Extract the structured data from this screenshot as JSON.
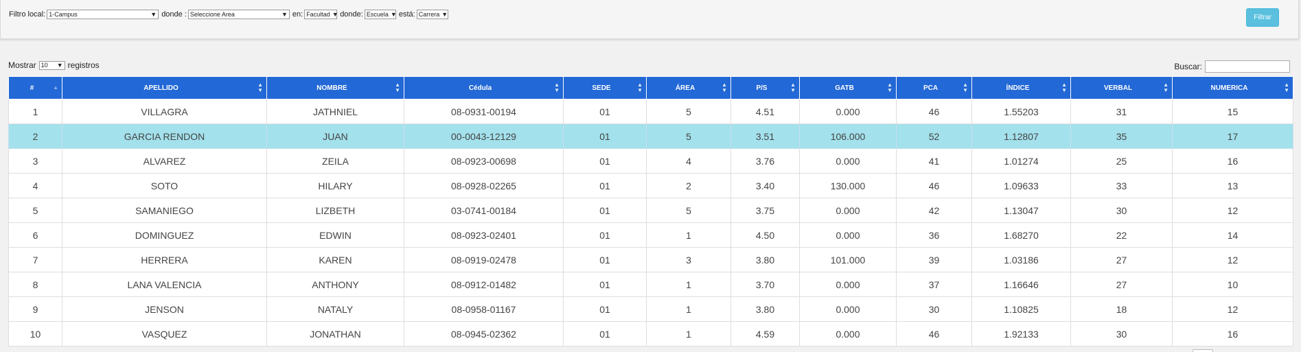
{
  "filters": {
    "local_label": "Filtro local:",
    "local_value": "1-Campus",
    "donde1_label": "donde :",
    "area_value": "Seleccione Area",
    "en_label": "en:",
    "facultad_value": "Facultad",
    "donde2_label": "donde:",
    "escuela_value": "Escuela",
    "esta_label": "está:",
    "carrera_value": "Carrera"
  },
  "filter_button": "Filtrar",
  "length": {
    "prefix": "Mostrar",
    "value": "10",
    "suffix": "registros"
  },
  "search": {
    "label": "Buscar:",
    "value": ""
  },
  "table": {
    "columns": [
      "#",
      "APELLIDO",
      "NOMBRE",
      "Cédula",
      "SEDE",
      "ÁREA",
      "P/S",
      "GATB",
      "PCA",
      "ÍNDICE",
      "VERBAL",
      "NUMERICA"
    ],
    "rows": [
      [
        "1",
        "VILLAGRA",
        "JATHNIEL",
        "08-0931-00194",
        "01",
        "5",
        "4.51",
        "0.000",
        "46",
        "1.55203",
        "31",
        "15"
      ],
      [
        "2",
        "GARCIA RENDON",
        "JUAN",
        "00-0043-12129",
        "01",
        "5",
        "3.51",
        "106.000",
        "52",
        "1.12807",
        "35",
        "17"
      ],
      [
        "3",
        "ALVAREZ",
        "ZEILA",
        "08-0923-00698",
        "01",
        "4",
        "3.76",
        "0.000",
        "41",
        "1.01274",
        "25",
        "16"
      ],
      [
        "4",
        "SOTO",
        "HILARY",
        "08-0928-02265",
        "01",
        "2",
        "3.40",
        "130.000",
        "46",
        "1.09633",
        "33",
        "13"
      ],
      [
        "5",
        "SAMANIEGO",
        "LIZBETH",
        "03-0741-00184",
        "01",
        "5",
        "3.75",
        "0.000",
        "42",
        "1.13047",
        "30",
        "12"
      ],
      [
        "6",
        "DOMINGUEZ",
        "EDWIN",
        "08-0923-02401",
        "01",
        "1",
        "4.50",
        "0.000",
        "36",
        "1.68270",
        "22",
        "14"
      ],
      [
        "7",
        "HERRERA",
        "KAREN",
        "08-0919-02478",
        "01",
        "3",
        "3.80",
        "101.000",
        "39",
        "1.03186",
        "27",
        "12"
      ],
      [
        "8",
        "LANA VALENCIA",
        "ANTHONY",
        "08-0912-01482",
        "01",
        "1",
        "3.70",
        "0.000",
        "37",
        "1.16646",
        "27",
        "10"
      ],
      [
        "9",
        "JENSON",
        "NATALY",
        "08-0958-01167",
        "01",
        "1",
        "3.80",
        "0.000",
        "30",
        "1.10825",
        "18",
        "12"
      ],
      [
        "10",
        "VASQUEZ",
        "JONATHAN",
        "08-0945-02362",
        "01",
        "1",
        "4.59",
        "0.000",
        "46",
        "1.92133",
        "30",
        "16"
      ]
    ],
    "selected_row": 1
  },
  "colors": {
    "header_bg": "#2268d6",
    "selected_row_bg": "#a3e1ec",
    "button_bg": "#5bc0de"
  }
}
